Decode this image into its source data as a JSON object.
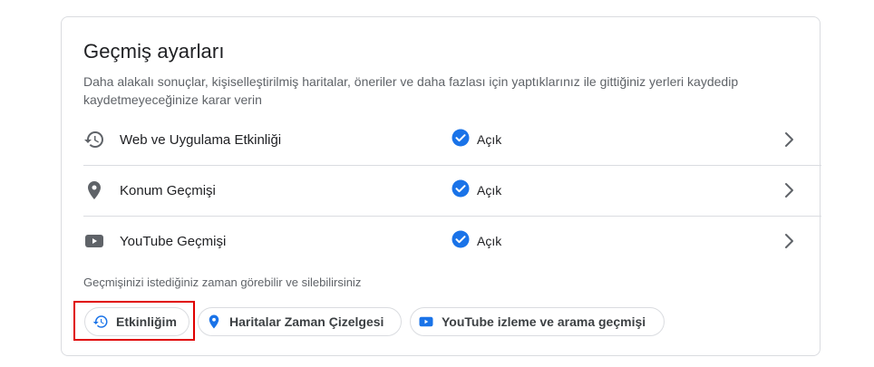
{
  "card": {
    "title": "Geçmiş ayarları",
    "description": "Daha alakalı sonuçlar, kişiselleştirilmiş haritalar, öneriler ve daha fazlası için yaptıklarınız ile gittiğiniz yerleri kaydedip kaydetmeyeceğinize karar verin"
  },
  "settings": [
    {
      "label": "Web ve Uygulama Etkinliği",
      "status": "Açık",
      "icon": "history-icon"
    },
    {
      "label": "Konum Geçmişi",
      "status": "Açık",
      "icon": "location-pin-icon"
    },
    {
      "label": "YouTube Geçmişi",
      "status": "Açık",
      "icon": "youtube-icon"
    }
  ],
  "footer": {
    "text": "Geçmişinizi istediğiniz zaman görebilir ve silebilirsiniz"
  },
  "chips": [
    {
      "label": "Etkinliğim",
      "icon": "history-icon"
    },
    {
      "label": "Haritalar Zaman Çizelgesi",
      "icon": "map-pin-icon"
    },
    {
      "label": "YouTube izleme ve arama geçmişi",
      "icon": "youtube-icon"
    }
  ],
  "colors": {
    "accent": "#1a73e8",
    "highlight": "#e00000",
    "border": "#dadce0",
    "icon_gray": "#5f6368"
  }
}
